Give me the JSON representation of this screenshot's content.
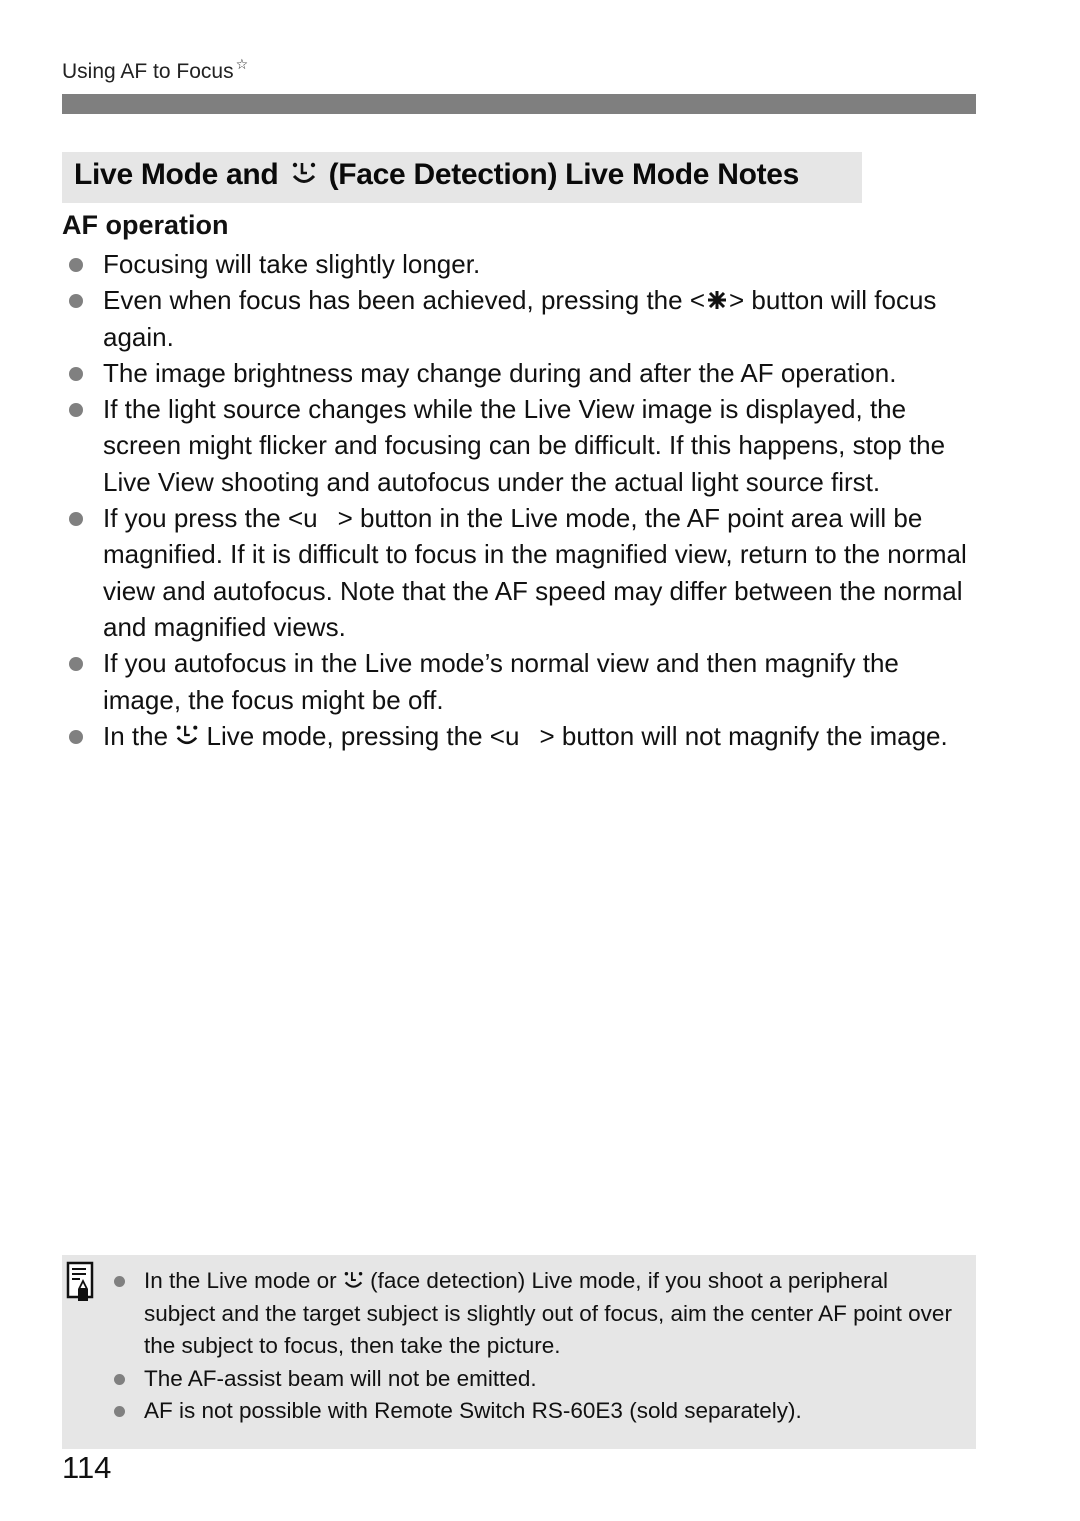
{
  "header": {
    "running_head": "Using AF to Focus",
    "running_head_marker": "☆"
  },
  "section": {
    "title_before_icon": "Live Mode and",
    "title_icon": "face-detection-icon",
    "title_after_icon": "(Face Detection) Live Mode Notes"
  },
  "af_operation": {
    "heading": "AF operation",
    "items": [
      {
        "text": "Focusing will take slightly longer."
      },
      {
        "before": "Even when focus has been achieved, pressing the <",
        "icon": "af-start-button-icon",
        "after": "> button will focus again."
      },
      {
        "text": "The image brightness may change during and after the AF operation."
      },
      {
        "text": "If the light source changes while the Live View image is displayed, the screen might flicker and focusing can be difficult. If this happens, stop the Live View shooting and autofocus under the actual light source first."
      },
      {
        "before": "If you press the <u",
        "after": "> button in the Live mode, the AF point area will be magnified. If it is difficult to focus in the magnified view, return to the normal view and autofocus. Note that the AF speed may differ between the normal and magnified views."
      },
      {
        "text": "If you autofocus in the Live mode’s normal view and then magnify the image, the focus might be off."
      },
      {
        "before": "In the",
        "icon": "face-detection-icon",
        "middle": "Live mode, pressing the <u",
        "after": "> button will not magnify the image."
      }
    ]
  },
  "note": {
    "icon": "memo-pencil-icon",
    "items": [
      {
        "before": "In the Live mode or",
        "icon": "face-detection-icon",
        "after": "(face detection) Live mode, if you shoot a peripheral subject and the target subject is slightly out of focus, aim the center AF point over the subject to focus, then take the picture."
      },
      {
        "text": "The AF-assist beam will not be emitted."
      },
      {
        "text": "AF is not possible with Remote Switch RS-60E3 (sold separately)."
      }
    ]
  },
  "footer": {
    "page_number": "114"
  },
  "colors": {
    "header_bar": "#7f7f7f",
    "title_background": "#e6e6e6",
    "note_background": "#e6e6e6",
    "bullet": "#808080",
    "text": "#111111"
  }
}
